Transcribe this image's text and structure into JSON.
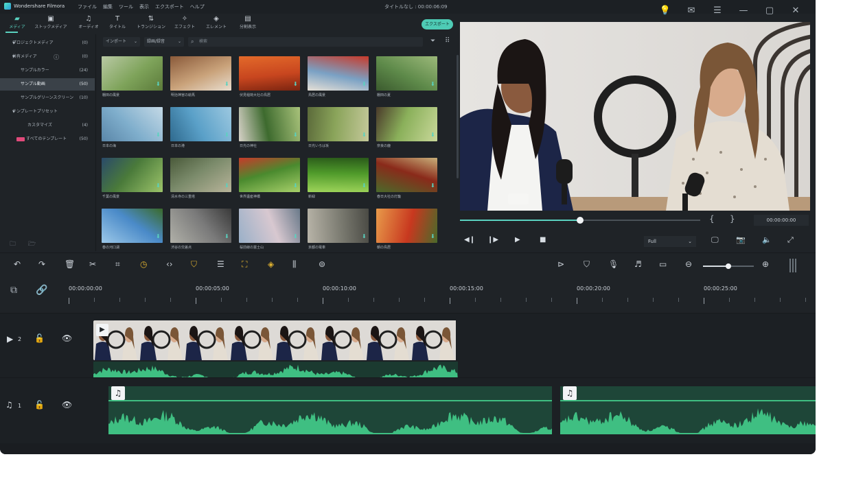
{
  "titlebar": {
    "app_name": "Wondershare Filmora",
    "menus": [
      "ファイル",
      "編集",
      "ツール",
      "表示",
      "エクスポート",
      "ヘルプ"
    ],
    "project": "タイトルなし : 00:00:06:09"
  },
  "media_tabs": [
    {
      "label": "メディア",
      "icon": "folder-icon"
    },
    {
      "label": "ストックメディア",
      "icon": "stock-media-icon"
    },
    {
      "label": "オーディオ",
      "icon": "music-note-icon"
    },
    {
      "label": "タイトル",
      "icon": "title-text-icon"
    },
    {
      "label": "トランジション",
      "icon": "transition-icon"
    },
    {
      "label": "エフェクト",
      "icon": "effects-icon"
    },
    {
      "label": "エレメント",
      "icon": "elements-icon"
    },
    {
      "label": "分割表示",
      "icon": "split-screen-icon"
    }
  ],
  "export_label": "エクスポート",
  "sidebar": {
    "items": [
      {
        "label": "プロジェクトメディア",
        "count": "(0)"
      },
      {
        "label": "共有メディア",
        "count": "(0)"
      },
      {
        "label": "サンプルカラー",
        "count": "(24)"
      },
      {
        "label": "サンプル動画",
        "count": "(50)"
      },
      {
        "label": "サンプルグリーンスクリーン",
        "count": "(10)"
      },
      {
        "label": "テンプレートプリセット",
        "count": ""
      },
      {
        "label": "カスタマイズ",
        "count": "(4)"
      },
      {
        "label": "すべてのテンプレート",
        "count": "(50)"
      }
    ]
  },
  "search": {
    "import_label": "インポート",
    "sort_label": "録画/録音",
    "placeholder": "検索"
  },
  "media_items": [
    {
      "caption": "棚田の風景"
    },
    {
      "caption": "明治神宮の絵馬"
    },
    {
      "caption": "伏見稲荷大社の鳥居"
    },
    {
      "caption": "鳥居の風景"
    },
    {
      "caption": "棚田の夏"
    },
    {
      "caption": "日本の海"
    },
    {
      "caption": "日本の港"
    },
    {
      "caption": "日光の神社"
    },
    {
      "caption": "日光いろは坂"
    },
    {
      "caption": "奈良の鹿"
    },
    {
      "caption": "千葉の風景"
    },
    {
      "caption": "清水寺の三重塔"
    },
    {
      "caption": "世界遺産神橋"
    },
    {
      "caption": "新緑"
    },
    {
      "caption": "春日大社の灯籠"
    },
    {
      "caption": "春の河口湖"
    },
    {
      "caption": "渋谷の交差点"
    },
    {
      "caption": "桜前線の富士山"
    },
    {
      "caption": "京都の電車"
    },
    {
      "caption": "朝の鳥居"
    }
  ],
  "preview": {
    "timecode": "00:00:00:00",
    "mark_in": "{",
    "mark_out": "}",
    "quality": "Full",
    "progress": 0.5
  },
  "ruler": {
    "labels": [
      "00:00:00:00",
      "00:00:05:00",
      "00:00:10:00",
      "00:00:15:00",
      "00:00:20:00",
      "00:00:25:00"
    ]
  },
  "tracks": {
    "video_number": "2",
    "audio_number": "1"
  },
  "zoom": {
    "level": 0.5
  },
  "colors": {
    "accent": "#5ad2c0",
    "audio_wave": "#3fbf82",
    "keyframe_yellow": "#e0b230"
  }
}
